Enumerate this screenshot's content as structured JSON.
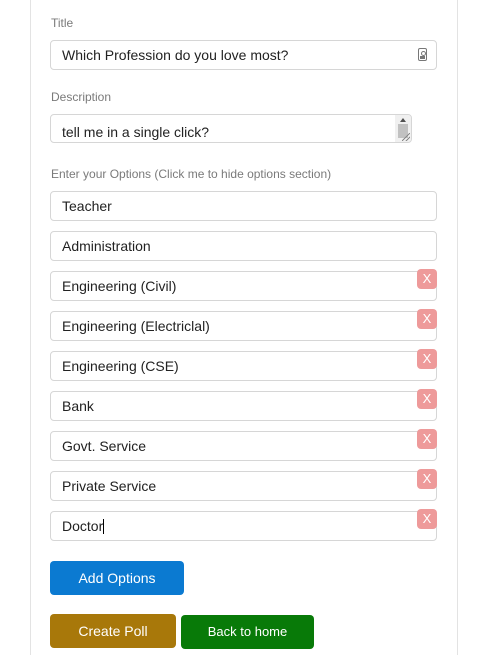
{
  "form": {
    "title_label": "Title",
    "title_value": "Which Profession do you love most?",
    "description_label": "Description",
    "description_value": "tell me in a single click?",
    "options_label": "Enter your Options (Click me to hide options section)",
    "options": [
      {
        "value": "Teacher",
        "removable": false
      },
      {
        "value": "Administration",
        "removable": false
      },
      {
        "value": "Engineering (Civil)",
        "removable": true
      },
      {
        "value": "Engineering (Electriclal)",
        "removable": true
      },
      {
        "value": "Engineering (CSE)",
        "removable": true
      },
      {
        "value": "Bank",
        "removable": true
      },
      {
        "value": "Govt. Service",
        "removable": true
      },
      {
        "value": "Private Service",
        "removable": true
      },
      {
        "value": "Doctor",
        "removable": true
      }
    ],
    "remove_label": "X"
  },
  "buttons": {
    "add_options": "Add Options",
    "create_poll": "Create Poll",
    "back_home": "Back to home"
  },
  "colors": {
    "add_options_bg": "#0b7ad1",
    "create_poll_bg": "#a8780a",
    "back_home_bg": "#087a08",
    "remove_bg": "#ee9a9a"
  },
  "icons": {
    "title_field": "contact-card-icon"
  }
}
